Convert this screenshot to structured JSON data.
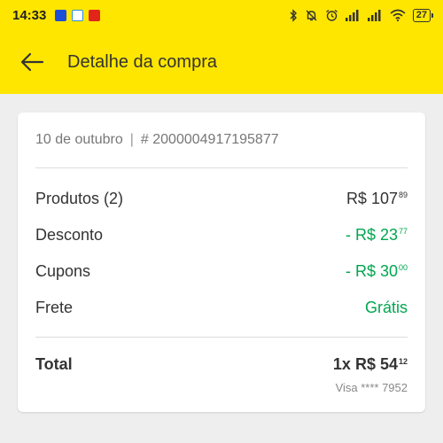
{
  "status_bar": {
    "time": "14:33",
    "battery": "27"
  },
  "app_bar": {
    "title": "Detalhe da compra"
  },
  "order": {
    "date": "10 de outubro",
    "separator": "|",
    "number": "# 2000004917195877"
  },
  "summary": [
    {
      "label": "Produtos (2)",
      "amount": "R$ 107",
      "cents": "89",
      "color": "#333333"
    },
    {
      "label": "Desconto",
      "amount": "- R$ 23",
      "cents": "77",
      "color": "#00a650"
    },
    {
      "label": "Cupons",
      "amount": "- R$ 30",
      "cents": "00",
      "color": "#00a650"
    },
    {
      "label": "Frete",
      "amount": "Grátis",
      "cents": "",
      "color": "#00a650"
    }
  ],
  "total": {
    "label": "Total",
    "amount": "1x R$ 54",
    "cents": "12",
    "payment": "Visa **** 7952"
  },
  "colors": {
    "brand_yellow": "#ffe600",
    "discount_green": "#00a650",
    "background": "#eeeeee"
  }
}
